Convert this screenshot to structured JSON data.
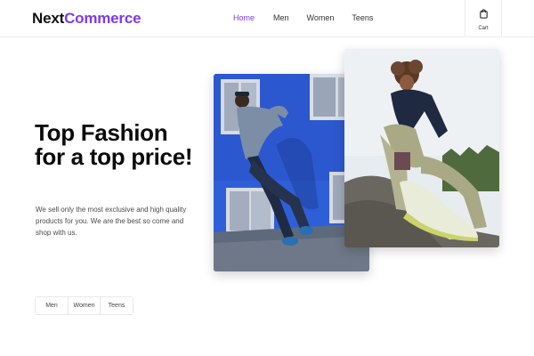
{
  "header": {
    "logo_part1": "Next",
    "logo_part2": "Commerce",
    "nav": [
      {
        "label": "Home",
        "active": true
      },
      {
        "label": "Men",
        "active": false
      },
      {
        "label": "Women",
        "active": false
      },
      {
        "label": "Teens",
        "active": false
      }
    ],
    "cart_label": "Cart",
    "cart_icon": "shopping-bag-icon"
  },
  "hero": {
    "title": "Top Fashion for a top price!",
    "description": "We sell only the most exclusive and high quality products for you. We are the best so come and shop with us."
  },
  "categories": [
    {
      "label": "Men"
    },
    {
      "label": "Women"
    },
    {
      "label": "Teens"
    }
  ],
  "colors": {
    "accent": "#7c3aed",
    "text": "#0b0b0b",
    "muted": "#4a4a4a",
    "border": "#ececec"
  }
}
